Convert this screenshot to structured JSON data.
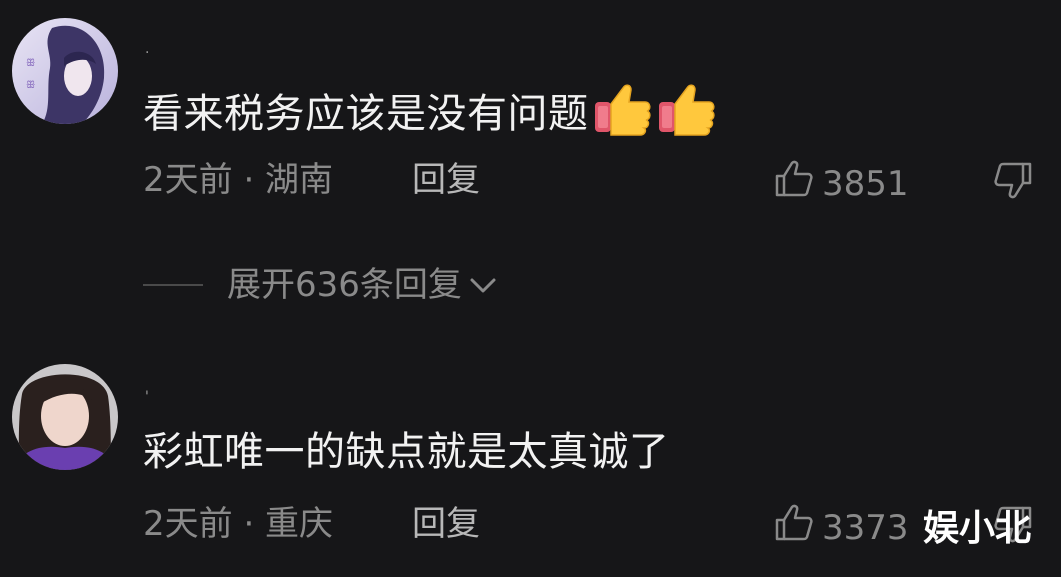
{
  "comments": [
    {
      "username": ".",
      "text": "看来税务应该是没有问题",
      "emoji": [
        "thumbs-up",
        "thumbs-up"
      ],
      "time_location": "2天前 · 湖南",
      "reply_label": "回复",
      "likes": "3851"
    },
    {
      "username": "'",
      "text": "彩虹唯一的缺点就是太真诚了",
      "time_location": "2天前 · 重庆",
      "reply_label": "回复",
      "likes": "3373"
    }
  ],
  "expand_replies": "展开636条回复",
  "watermark": "娱小北",
  "icons": {
    "like": "thumbs-up-outline-icon",
    "dislike": "thumbs-down-outline-icon",
    "expand": "chevron-down-icon"
  },
  "colors": {
    "background": "#161618",
    "text_primary": "#f2f2f2",
    "text_secondary": "#8a8a8a"
  }
}
